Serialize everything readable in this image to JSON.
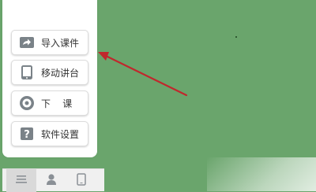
{
  "menu": {
    "items": [
      {
        "label": "导入课件",
        "icon": "import-courseware-icon"
      },
      {
        "label": "移动讲台",
        "icon": "mobile-podium-icon"
      },
      {
        "label": "下    课",
        "icon": "end-class-icon"
      },
      {
        "label": "软件设置",
        "icon": "software-settings-icon"
      }
    ]
  },
  "dock": {
    "buttons": [
      {
        "icon": "menu-lines-icon",
        "active": true
      },
      {
        "icon": "user-icon",
        "active": false
      },
      {
        "icon": "tablet-icon",
        "active": false
      }
    ]
  },
  "colors": {
    "board": "#6aa56c",
    "arrow": "#c0282d",
    "icon": "#7a8288",
    "menu_bg": "#ffffff",
    "dock_bg": "#f0f0f0"
  }
}
